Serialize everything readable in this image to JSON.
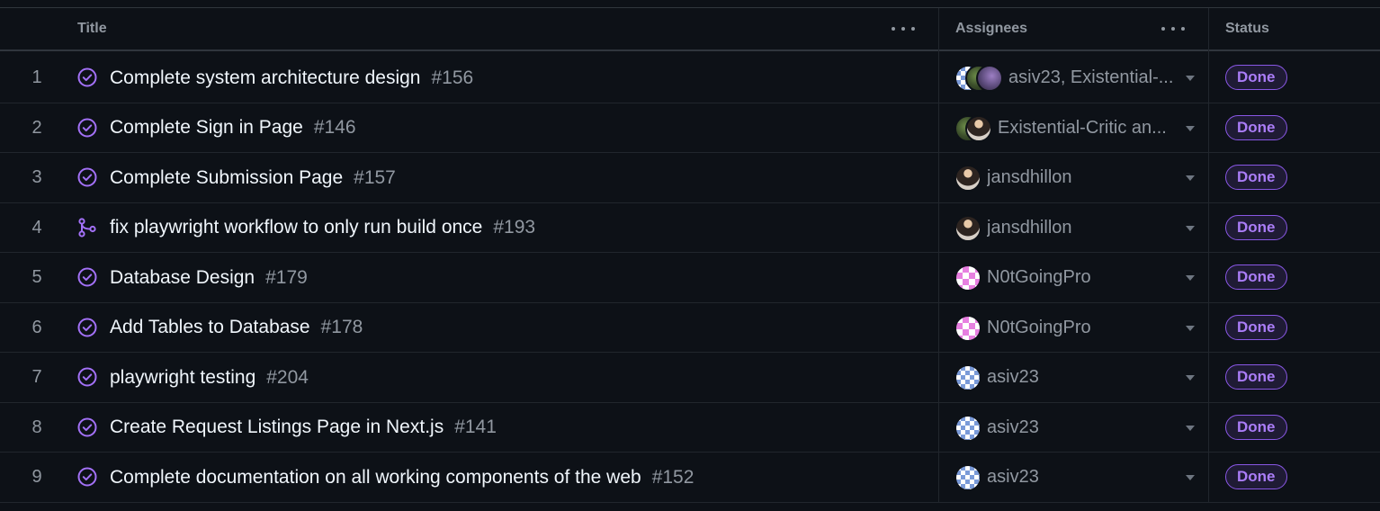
{
  "header": {
    "title_col": "Title",
    "assignees_col": "Assignees",
    "status_col": "Status"
  },
  "colors": {
    "background": "#0d1117",
    "done_purple": "#ab7df8",
    "icon_purple": "#a371f7"
  },
  "rows": [
    {
      "num": "1",
      "icon": "issue-closed-icon",
      "title": "Complete system architecture design",
      "issue": "#156",
      "assignees": "asiv23, Existential-...",
      "avatars": [
        "av-blue",
        "av-green",
        "av-purple"
      ],
      "status": "Done"
    },
    {
      "num": "2",
      "icon": "issue-closed-icon",
      "title": "Complete Sign in Page",
      "issue": "#146",
      "assignees": "Existential-Critic an...",
      "avatars": [
        "av-green",
        "av-person"
      ],
      "status": "Done"
    },
    {
      "num": "3",
      "icon": "issue-closed-icon",
      "title": "Complete Submission Page",
      "issue": "#157",
      "assignees": "jansdhillon",
      "avatars": [
        "av-person"
      ],
      "status": "Done"
    },
    {
      "num": "4",
      "icon": "pull-request-merged-icon",
      "title": "fix playwright workflow to only run build once",
      "issue": "#193",
      "assignees": "jansdhillon",
      "avatars": [
        "av-person"
      ],
      "status": "Done"
    },
    {
      "num": "5",
      "icon": "issue-closed-icon",
      "title": "Database Design",
      "issue": "#179",
      "assignees": "N0tGoingPro",
      "avatars": [
        "av-pink"
      ],
      "status": "Done"
    },
    {
      "num": "6",
      "icon": "issue-closed-icon",
      "title": "Add Tables to Database",
      "issue": "#178",
      "assignees": "N0tGoingPro",
      "avatars": [
        "av-pink"
      ],
      "status": "Done"
    },
    {
      "num": "7",
      "icon": "issue-closed-icon",
      "title": "playwright testing",
      "issue": "#204",
      "assignees": "asiv23",
      "avatars": [
        "av-blue"
      ],
      "status": "Done"
    },
    {
      "num": "8",
      "icon": "issue-closed-icon",
      "title": "Create Request Listings Page in Next.js",
      "issue": "#141",
      "assignees": "asiv23",
      "avatars": [
        "av-blue"
      ],
      "status": "Done"
    },
    {
      "num": "9",
      "icon": "issue-closed-icon",
      "title": "Complete documentation on all working components of the web",
      "issue": "#152",
      "assignees": "asiv23",
      "avatars": [
        "av-blue"
      ],
      "status": "Done"
    }
  ]
}
